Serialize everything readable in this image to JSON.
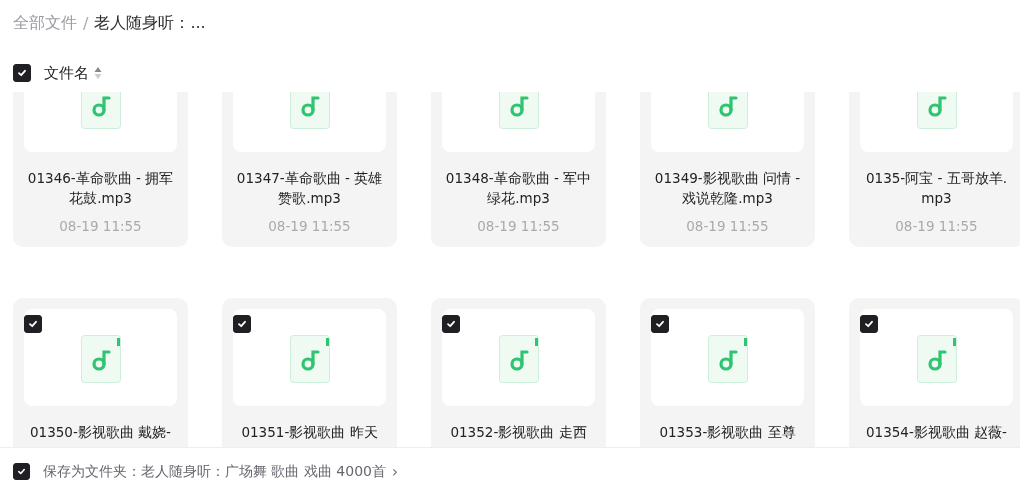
{
  "breadcrumb": [
    {
      "label": "全部文件",
      "current": false
    },
    {
      "label": "老人随身听：...",
      "current": true
    }
  ],
  "breadcrumb_separator": "/",
  "header": {
    "checked": true,
    "label": "文件名"
  },
  "files": [
    {
      "name": "01346-革命歌曲 - 拥军花鼓.mp3",
      "date": "08-19 11:55"
    },
    {
      "name": "01347-革命歌曲 - 英雄赞歌.mp3",
      "date": "08-19 11:55"
    },
    {
      "name": "01348-革命歌曲 - 军中绿花.mp3",
      "date": "08-19 11:55"
    },
    {
      "name": "01349-影视歌曲 问情 - 戏说乾隆.mp3",
      "date": "08-19 11:55"
    },
    {
      "name": "0135-阿宝 - 五哥放羊.mp3",
      "date": "08-19 11:55"
    },
    {
      "name": "01350-影视歌曲 戴娆-",
      "checked": true
    },
    {
      "name": "01351-影视歌曲 昨天",
      "checked": true
    },
    {
      "name": "01352-影视歌曲 走西",
      "checked": true
    },
    {
      "name": "01353-影视歌曲 至尊",
      "checked": true
    },
    {
      "name": "01354-影视歌曲 赵薇-",
      "checked": true
    }
  ],
  "footer": {
    "checked": true,
    "text": "保存为文件夹：老人随身听：广场舞 歌曲 戏曲 4000首",
    "chevron": "›"
  }
}
